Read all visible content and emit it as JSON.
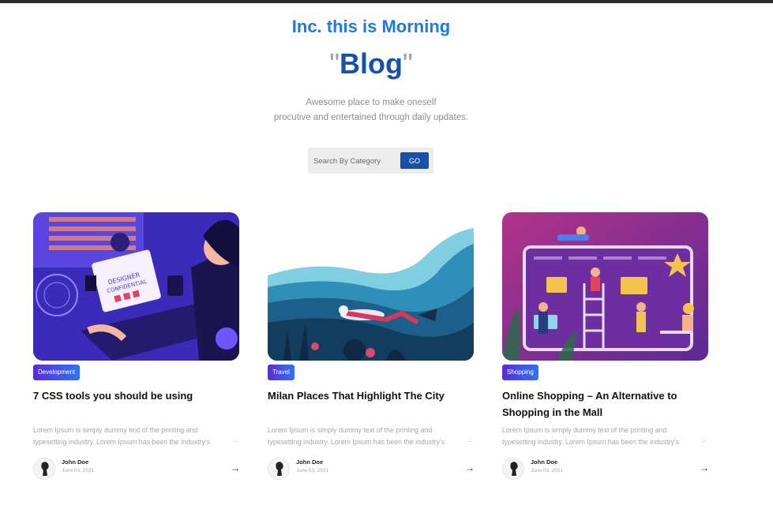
{
  "hero": {
    "subtitle": "Inc. this is Morning",
    "title_open_quote": "\"",
    "title": "Blog",
    "title_close_quote": "\"",
    "description_line1": "Awesome place to make oneself",
    "description_line2": "procutive and entertained through daily updates."
  },
  "search": {
    "placeholder": "Search By Category",
    "button_label": "GO"
  },
  "posts": [
    {
      "category": "Development",
      "title": "7 CSS tools you should be using",
      "excerpt": "Lorem Ipsum is simply dummy text of the printing and typesetting industry. Lorem Ipsum has been the industry's",
      "more": "...",
      "author": "John Doe",
      "date": "June 03, 2021",
      "arrow": "→",
      "image_icon": "illustration-desk-laptop"
    },
    {
      "category": "Travel",
      "title": "Milan Places That Highlight The City",
      "excerpt": "Lorem Ipsum is simply dummy text of the printing and typesetting industry. Lorem Ipsum has been the industry's",
      "more": "...",
      "author": "John Doe",
      "date": "June 03, 2021",
      "arrow": "→",
      "image_icon": "illustration-diver-underwater"
    },
    {
      "category": "Shopping",
      "title": "Online Shopping – An Alternative to Shopping in the Mall",
      "excerpt": "Lorem Ipsum is simply dummy text of the printing and typesetting industry. Lorem Ipsum has been the industry's",
      "more": "...",
      "author": "John Doe",
      "date": "June 03, 2021",
      "arrow": "→",
      "image_icon": "illustration-online-shopping"
    }
  ],
  "colors": {
    "accent_light": "#1f7ae0",
    "accent_dark": "#1552a8",
    "badge_gradient_start": "#5b2bd6",
    "badge_gradient_end": "#2f74f0"
  }
}
